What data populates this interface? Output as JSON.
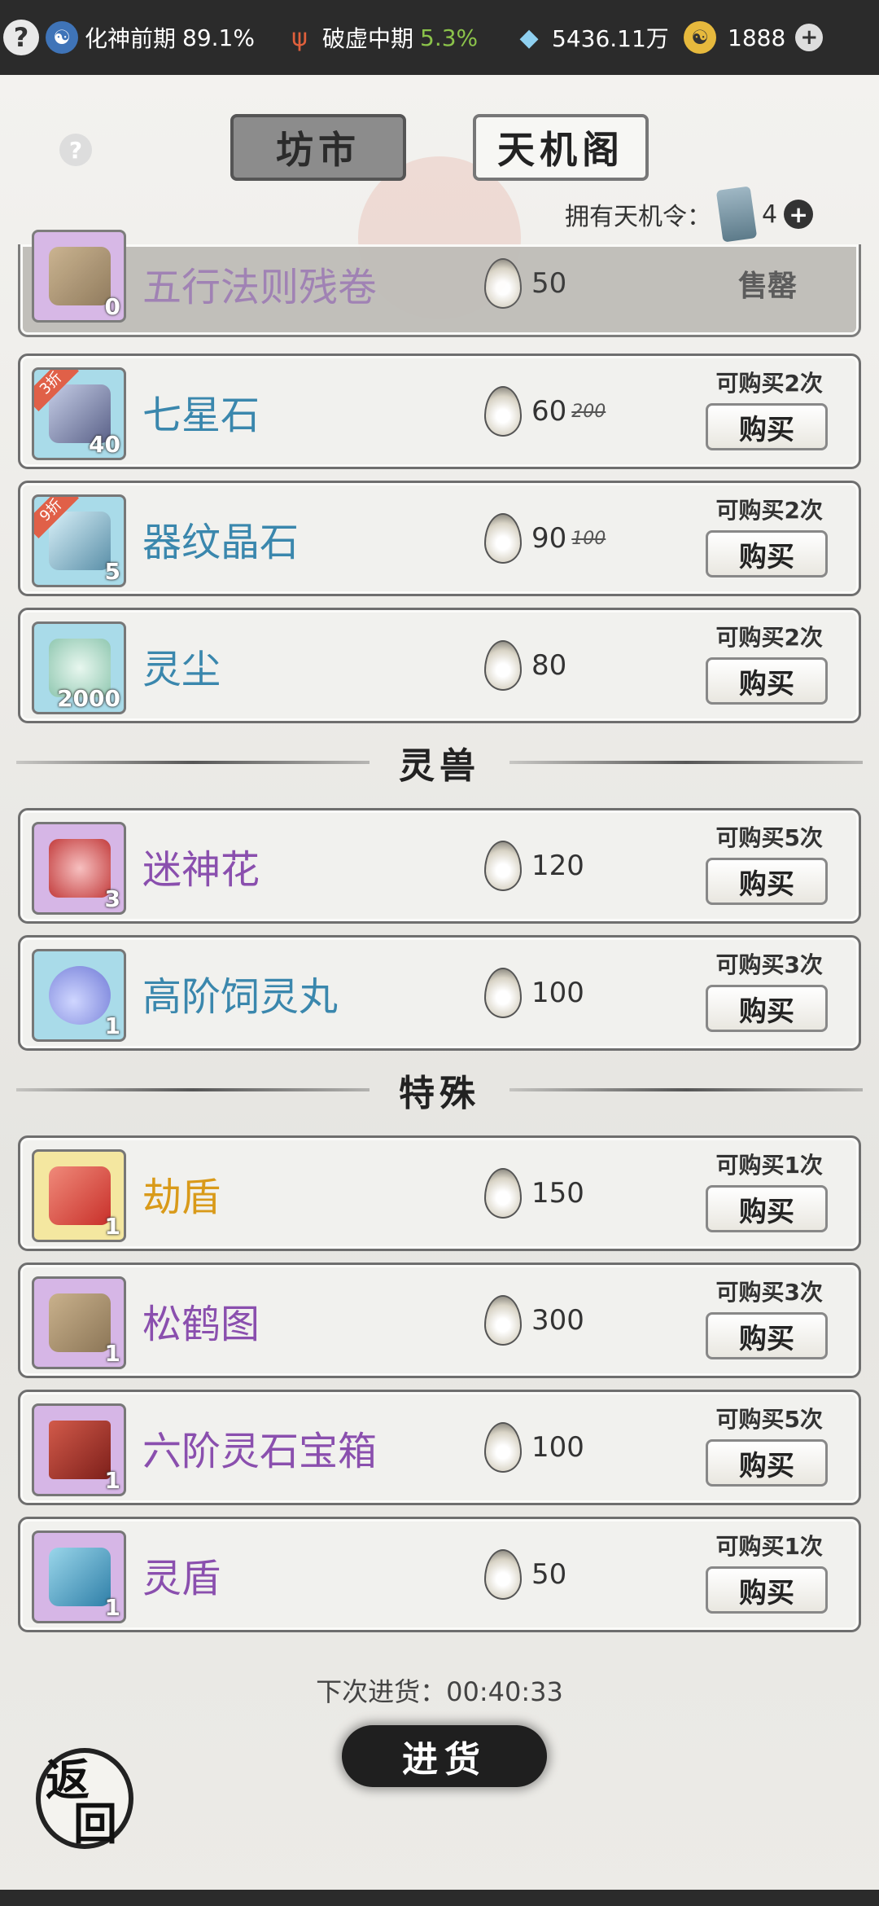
{
  "topbar": {
    "help": "?",
    "realm_icon": "yin-yang-icon",
    "realm_label": "化神前期",
    "realm_percent": "89.1%",
    "tribulation_icon": "trident-icon",
    "tribulation_label": "破虚中期",
    "tribulation_percent": "5.3%",
    "spirit_stone_icon": "crystal-icon",
    "spirit_stone_value": "5436.11万",
    "jade_icon": "jade-coin-icon",
    "jade_value": "1888",
    "add": "+"
  },
  "tabs": {
    "market": "坊市",
    "tianji": "天机阁",
    "help": "?"
  },
  "owned": {
    "label": "拥有天机令：",
    "count": "4",
    "add": "+"
  },
  "items": [
    {
      "name": "五行法则残卷",
      "qty": "0",
      "price": "50",
      "sold_out": "售罄",
      "rarity": "purple"
    },
    {
      "name": "七星石",
      "qty": "40",
      "price": "60",
      "original": "200",
      "discount": "3折",
      "limit": "可购买2次",
      "buy": "购买",
      "rarity": "blue"
    },
    {
      "name": "器纹晶石",
      "qty": "5",
      "price": "90",
      "original": "100",
      "discount": "9折",
      "limit": "可购买2次",
      "buy": "购买",
      "rarity": "blue"
    },
    {
      "name": "灵尘",
      "qty": "2000",
      "price": "80",
      "limit": "可购买2次",
      "buy": "购买",
      "rarity": "blue"
    },
    {
      "name": "迷神花",
      "qty": "3",
      "price": "120",
      "limit": "可购买5次",
      "buy": "购买",
      "rarity": "purple"
    },
    {
      "name": "高阶饲灵丸",
      "qty": "1",
      "price": "100",
      "limit": "可购买3次",
      "buy": "购买",
      "rarity": "blue"
    },
    {
      "name": "劫盾",
      "qty": "1",
      "price": "150",
      "limit": "可购买1次",
      "buy": "购买",
      "rarity": "gold"
    },
    {
      "name": "松鹤图",
      "qty": "1",
      "price": "300",
      "limit": "可购买3次",
      "buy": "购买",
      "rarity": "purple"
    },
    {
      "name": "六阶灵石宝箱",
      "qty": "1",
      "price": "100",
      "limit": "可购买5次",
      "buy": "购买",
      "rarity": "purple"
    },
    {
      "name": "灵盾",
      "qty": "1",
      "price": "50",
      "limit": "可购买1次",
      "buy": "购买",
      "rarity": "purple"
    }
  ],
  "sections": {
    "beast": "灵兽",
    "special": "特殊"
  },
  "restock": {
    "time_text": "下次进货：00:40:33",
    "button": "进货"
  },
  "back": {
    "label_1": "返",
    "label_2": "回"
  }
}
